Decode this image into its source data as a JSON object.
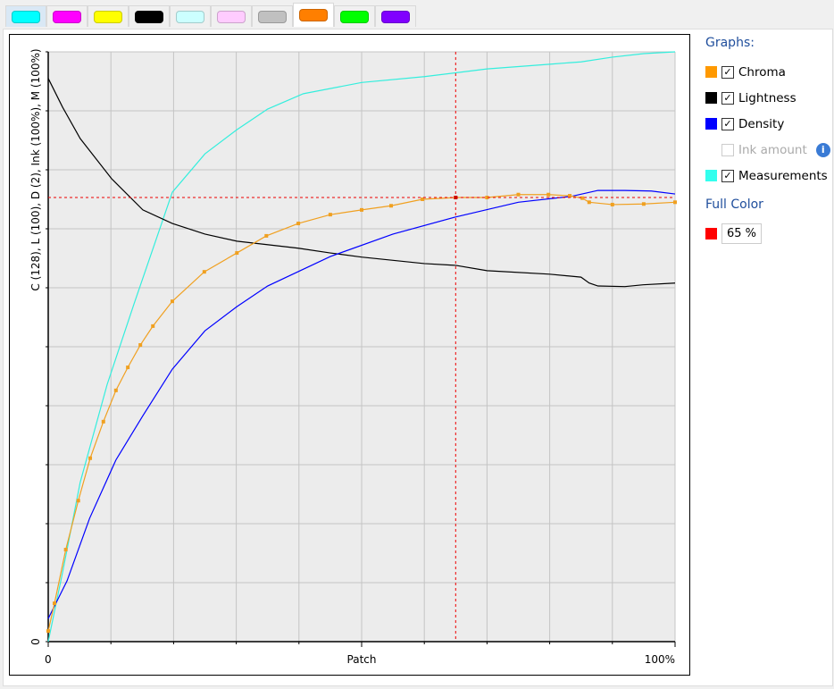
{
  "tabs": [
    {
      "name": "cyan",
      "color": "#00ffff"
    },
    {
      "name": "magenta",
      "color": "#ff00ff"
    },
    {
      "name": "yellow",
      "color": "#ffff00"
    },
    {
      "name": "black",
      "color": "#000000"
    },
    {
      "name": "light-cyan",
      "color": "#ccffff"
    },
    {
      "name": "light-magenta",
      "color": "#ffccff"
    },
    {
      "name": "gray",
      "color": "#c0c0c0"
    },
    {
      "name": "orange",
      "color": "#ff7f00",
      "active": true
    },
    {
      "name": "green",
      "color": "#00ff00"
    },
    {
      "name": "violet",
      "color": "#8000ff"
    }
  ],
  "side": {
    "graphs_label": "Graphs:",
    "items": [
      {
        "label": "Chroma",
        "color": "#ff9900",
        "checked": true
      },
      {
        "label": "Lightness",
        "color": "#000000",
        "checked": true
      },
      {
        "label": "Density",
        "color": "#0000ff",
        "checked": true
      },
      {
        "label": "Ink amount",
        "checked": false,
        "disabled": true
      },
      {
        "label": "Measurements",
        "color": "#33ffee",
        "checked": true
      }
    ],
    "full_color_label": "Full Color",
    "full_color_swatch": "#ff0000",
    "full_color_value": "65 %"
  },
  "chart_data": {
    "type": "line",
    "xlabel": "Patch",
    "ylabel": "C (128), L (100), D (2), Ink (100%), M (100%)",
    "x_tick_labels": [
      "0",
      "100%"
    ],
    "y_tick_label": "0",
    "xlim": [
      0,
      100
    ],
    "ylim": [
      0,
      100
    ],
    "grid": true,
    "crosshair": {
      "x": 65,
      "y": 75.3
    },
    "series": [
      {
        "name": "Measurements",
        "color": "#33eedd",
        "x": [
          0,
          2.3,
          5.1,
          9.4,
          13.7,
          19.8,
          25,
          30.1,
          35,
          40.7,
          50,
          60,
          70,
          80,
          85,
          90,
          95,
          100
        ],
        "y": [
          0,
          11.8,
          27,
          43.6,
          57.3,
          76.2,
          82.7,
          86.8,
          90.3,
          92.9,
          94.8,
          95.8,
          97.1,
          97.9,
          98.3,
          99.1,
          99.7,
          100
        ]
      },
      {
        "name": "Lightness",
        "color": "#000000",
        "x": [
          0,
          2.3,
          5.1,
          10.1,
          15.1,
          19.8,
          25,
          30.1,
          39.9,
          45,
          50,
          60,
          65,
          70,
          80,
          85,
          86.3,
          87.7,
          92,
          94.9,
          100
        ],
        "y": [
          95.5,
          90.6,
          85.3,
          78.5,
          73.2,
          70.9,
          69.1,
          67.9,
          66.7,
          65.9,
          65.2,
          64.1,
          63.8,
          62.9,
          62.3,
          61.8,
          60.8,
          60.3,
          60.2,
          60.5,
          60.8
        ]
      },
      {
        "name": "Density",
        "color": "#0000ff",
        "x": [
          0,
          3,
          6.6,
          10.8,
          15.1,
          19.8,
          25,
          30.1,
          35,
          45,
          55,
          65,
          75,
          83.5,
          87.7,
          92,
          96.2,
          100
        ],
        "y": [
          3.9,
          10.3,
          20.9,
          30.8,
          38.3,
          46.2,
          52.7,
          56.8,
          60.3,
          65.3,
          69.1,
          72,
          74.5,
          75.5,
          76.5,
          76.5,
          76.4,
          75.9
        ]
      },
      {
        "name": "Chroma",
        "color": "#f0a020",
        "markers": true,
        "x": [
          0,
          1,
          2.8,
          4.8,
          6.7,
          8.8,
          10.8,
          12.7,
          14.7,
          16.7,
          19.8,
          24.9,
          30.1,
          34.8,
          39.9,
          45,
          50,
          54.7,
          59.7,
          65,
          70,
          75,
          79.8,
          83.2,
          85.2,
          86.3,
          90,
          95,
          100
        ],
        "y": [
          1.8,
          6.5,
          15.6,
          23.9,
          31.1,
          37.3,
          42.6,
          46.5,
          50.3,
          53.5,
          57.7,
          62.7,
          65.9,
          68.8,
          70.9,
          72.4,
          73.2,
          73.9,
          75,
          75.3,
          75.3,
          75.8,
          75.8,
          75.6,
          75.2,
          74.5,
          74.1,
          74.2,
          74.5
        ]
      }
    ]
  }
}
